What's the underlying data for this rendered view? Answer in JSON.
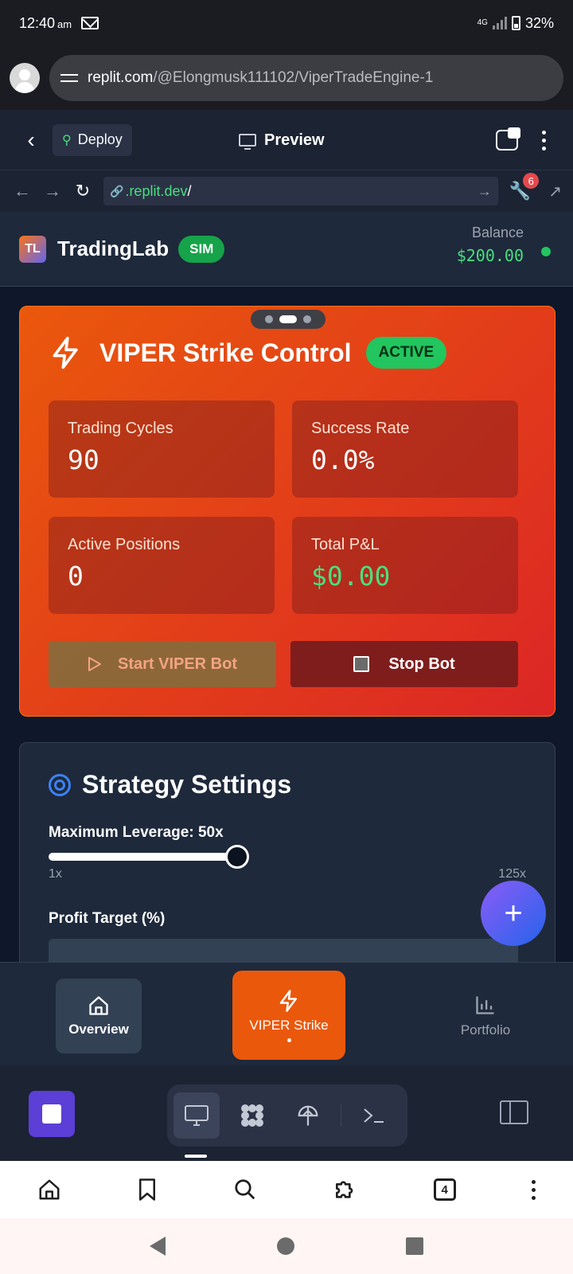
{
  "status_bar": {
    "time": "12:40",
    "ampm": "am",
    "network": "4G",
    "battery": "32%"
  },
  "browser": {
    "url_host": "replit.com",
    "url_path": "/@Elongmusk111102/ViperTradeEngine-1",
    "tab_count": "4"
  },
  "replit": {
    "deploy_label": "Deploy",
    "preview_label": "Preview",
    "dev_url_domain": ".replit.dev",
    "dev_url_path": "/",
    "notification_count": "6"
  },
  "app": {
    "logo_text": "TL",
    "name": "TradingLab",
    "mode_badge": "SIM",
    "balance_label": "Balance",
    "balance_value": "$200.00"
  },
  "viper_card": {
    "title": "VIPER Strike Control",
    "status_badge": "ACTIVE",
    "stats": [
      {
        "label": "Trading Cycles",
        "value": "90"
      },
      {
        "label": "Success Rate",
        "value": "0.0%"
      },
      {
        "label": "Active Positions",
        "value": "0"
      },
      {
        "label": "Total P&L",
        "value": "$0.00"
      }
    ],
    "start_label": "Start VIPER Bot",
    "stop_label": "Stop Bot",
    "pager": {
      "pages": 3,
      "active": 2
    }
  },
  "settings": {
    "title": "Strategy Settings",
    "leverage_label": "Maximum Leverage: 50x",
    "leverage_value": 50,
    "leverage_min_label": "1x",
    "leverage_max_label": "125x",
    "profit_target_label": "Profit Target (%)"
  },
  "app_nav": {
    "items": [
      {
        "label": "Overview",
        "icon": "home-icon"
      },
      {
        "label": "VIPER Strike",
        "icon": "bolt-icon"
      },
      {
        "label": "Portfolio",
        "icon": "bar-chart-icon"
      }
    ],
    "active": "VIPER Strike"
  },
  "colors": {
    "accent_orange": "#ea580c",
    "accent_red": "#dc2626",
    "success_green": "#22c55e",
    "pnl_green": "#4ade80",
    "stop_red": "#7f1d1d",
    "fab_gradient_start": "#8b5cf6",
    "fab_gradient_end": "#2563eb"
  }
}
